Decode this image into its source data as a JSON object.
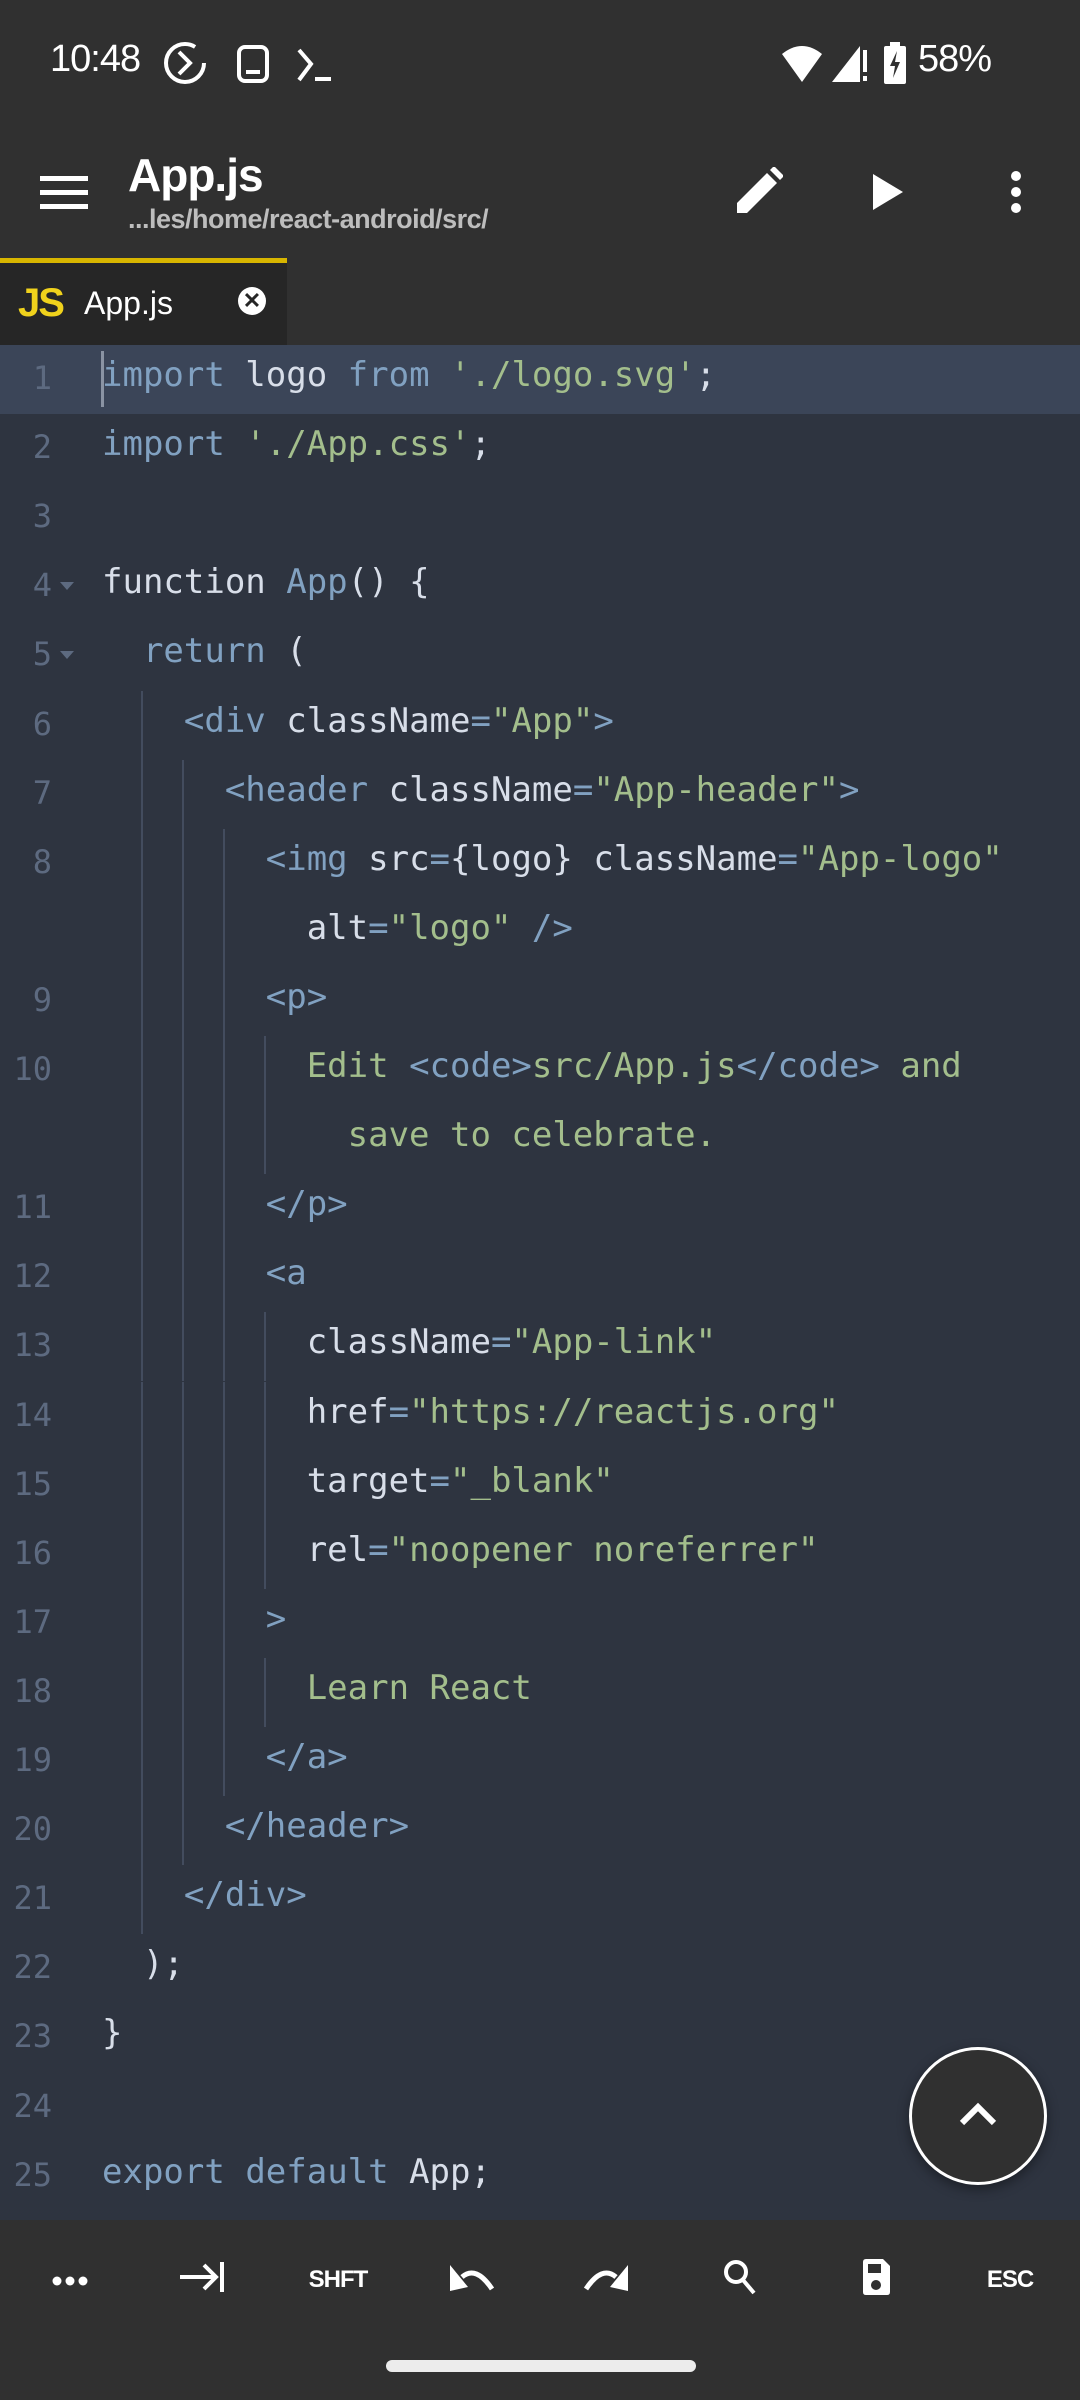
{
  "status_bar": {
    "time": "10:48",
    "left_icons": [
      "data-saver-icon",
      "tablet-icon",
      "terminal-icon"
    ],
    "right_icons": [
      "wifi-icon",
      "cell-signal-alert-icon",
      "battery-charging-icon"
    ],
    "battery_percent": "58%"
  },
  "app_bar": {
    "title": "App.js",
    "subtitle": "...les/home/react-android/src/",
    "actions": [
      "menu-icon",
      "edit-icon",
      "run-icon",
      "more-vert-icon"
    ]
  },
  "tabs": [
    {
      "icon_label": "JS",
      "label": "App.js",
      "active": true,
      "accent": "#d7b500"
    }
  ],
  "editor": {
    "active_line": 1,
    "theme_colors": {
      "background": "#2e3440",
      "active_line": "#3b4558",
      "keyword": "#81a1c1",
      "string": "#a3be8c",
      "text": "#d8dee9",
      "line_number": "#5d6a80"
    },
    "lines": [
      {
        "n": "1",
        "fold": false,
        "indent": 0,
        "wrap": false,
        "tokens": [
          [
            "k",
            "import"
          ],
          [
            "p",
            " logo "
          ],
          [
            "k",
            "from"
          ],
          [
            "p",
            " "
          ],
          [
            "s",
            "'./logo.svg'"
          ],
          [
            "p",
            ";"
          ]
        ]
      },
      {
        "n": "2",
        "fold": false,
        "indent": 0,
        "tokens": [
          [
            "k",
            "import"
          ],
          [
            "p",
            " "
          ],
          [
            "s",
            "'./App.css'"
          ],
          [
            "p",
            ";"
          ]
        ]
      },
      {
        "n": "3",
        "fold": false,
        "indent": 0,
        "tokens": []
      },
      {
        "n": "4",
        "fold": true,
        "indent": 0,
        "tokens": [
          [
            "p",
            "function "
          ],
          [
            "k",
            "App"
          ],
          [
            "p",
            "() {"
          ]
        ]
      },
      {
        "n": "5",
        "fold": true,
        "indent": 0,
        "tokens": [
          [
            "p",
            "  "
          ],
          [
            "k",
            "return"
          ],
          [
            "p",
            " ("
          ]
        ]
      },
      {
        "n": "6",
        "fold": false,
        "indent": 1,
        "tokens": [
          [
            "p",
            "    "
          ],
          [
            "k",
            "<div"
          ],
          [
            "p",
            " className"
          ],
          [
            "k",
            "="
          ],
          [
            "s",
            "\"App\""
          ],
          [
            "k",
            ">"
          ]
        ]
      },
      {
        "n": "7",
        "fold": false,
        "indent": 2,
        "tokens": [
          [
            "p",
            "      "
          ],
          [
            "k",
            "<header"
          ],
          [
            "p",
            " className"
          ],
          [
            "k",
            "="
          ],
          [
            "s",
            "\"App-header\""
          ],
          [
            "k",
            ">"
          ]
        ]
      },
      {
        "n": "8",
        "fold": false,
        "indent": 3,
        "tokens": [
          [
            "p",
            "        "
          ],
          [
            "k",
            "<img"
          ],
          [
            "p",
            " src"
          ],
          [
            "k",
            "="
          ],
          [
            "p",
            "{logo} className"
          ],
          [
            "k",
            "="
          ],
          [
            "s",
            "\"App-logo\""
          ]
        ]
      },
      {
        "n": "",
        "fold": false,
        "indent": 0,
        "wrap": true,
        "tokens": [
          [
            "p",
            "          alt"
          ],
          [
            "k",
            "="
          ],
          [
            "s",
            "\"logo\""
          ],
          [
            "p",
            " "
          ],
          [
            "k",
            "/>"
          ]
        ]
      },
      {
        "n": "9",
        "fold": false,
        "indent": 3,
        "tokens": [
          [
            "p",
            "        "
          ],
          [
            "k",
            "<p>"
          ]
        ]
      },
      {
        "n": "10",
        "fold": false,
        "indent": 4,
        "tokens": [
          [
            "p",
            "          "
          ],
          [
            "s",
            "Edit "
          ],
          [
            "k",
            "<code>"
          ],
          [
            "s",
            "src/App.js"
          ],
          [
            "k",
            "</code>"
          ],
          [
            "s",
            " and"
          ]
        ]
      },
      {
        "n": "",
        "fold": false,
        "indent": 0,
        "wrap": true,
        "tokens": [
          [
            "s",
            "            save to celebrate."
          ]
        ]
      },
      {
        "n": "11",
        "fold": false,
        "indent": 3,
        "tokens": [
          [
            "p",
            "        "
          ],
          [
            "k",
            "</p>"
          ]
        ]
      },
      {
        "n": "12",
        "fold": false,
        "indent": 3,
        "tokens": [
          [
            "p",
            "        "
          ],
          [
            "k",
            "<a"
          ]
        ]
      },
      {
        "n": "13",
        "fold": false,
        "indent": 4,
        "tokens": [
          [
            "p",
            "          className"
          ],
          [
            "k",
            "="
          ],
          [
            "s",
            "\"App-link\""
          ]
        ]
      },
      {
        "n": "14",
        "fold": false,
        "indent": 4,
        "tokens": [
          [
            "p",
            "          href"
          ],
          [
            "k",
            "="
          ],
          [
            "s",
            "\"https://reactjs.org\""
          ]
        ]
      },
      {
        "n": "15",
        "fold": false,
        "indent": 4,
        "tokens": [
          [
            "p",
            "          target"
          ],
          [
            "k",
            "="
          ],
          [
            "s",
            "\"_blank\""
          ]
        ]
      },
      {
        "n": "16",
        "fold": false,
        "indent": 4,
        "tokens": [
          [
            "p",
            "          rel"
          ],
          [
            "k",
            "="
          ],
          [
            "s",
            "\"noopener noreferrer\""
          ]
        ]
      },
      {
        "n": "17",
        "fold": false,
        "indent": 3,
        "tokens": [
          [
            "p",
            "        "
          ],
          [
            "k",
            ">"
          ]
        ]
      },
      {
        "n": "18",
        "fold": false,
        "indent": 4,
        "tokens": [
          [
            "p",
            "          "
          ],
          [
            "s",
            "Learn React"
          ]
        ]
      },
      {
        "n": "19",
        "fold": false,
        "indent": 3,
        "tokens": [
          [
            "p",
            "        "
          ],
          [
            "k",
            "</a>"
          ]
        ]
      },
      {
        "n": "20",
        "fold": false,
        "indent": 2,
        "tokens": [
          [
            "p",
            "      "
          ],
          [
            "k",
            "</header>"
          ]
        ]
      },
      {
        "n": "21",
        "fold": false,
        "indent": 1,
        "tokens": [
          [
            "p",
            "    "
          ],
          [
            "k",
            "</div>"
          ]
        ]
      },
      {
        "n": "22",
        "fold": false,
        "indent": 0,
        "tokens": [
          [
            "p",
            "  );"
          ]
        ]
      },
      {
        "n": "23",
        "fold": false,
        "indent": 0,
        "tokens": [
          [
            "p",
            "}"
          ]
        ]
      },
      {
        "n": "24",
        "fold": false,
        "indent": 0,
        "tokens": []
      },
      {
        "n": "25",
        "fold": false,
        "indent": 0,
        "tokens": [
          [
            "k",
            "export"
          ],
          [
            "p",
            " "
          ],
          [
            "k",
            "default"
          ],
          [
            "p",
            " App;"
          ]
        ]
      }
    ]
  },
  "fab": {
    "icon": "chevron-up-icon"
  },
  "bottom_toolbar": {
    "items": [
      {
        "name": "more-keys-button",
        "icon": "more-horiz-icon",
        "label": ""
      },
      {
        "name": "tab-key-button",
        "icon": "tab-icon",
        "label": ""
      },
      {
        "name": "shift-key-button",
        "icon": "",
        "label": "SHFT"
      },
      {
        "name": "undo-button",
        "icon": "undo-icon",
        "label": ""
      },
      {
        "name": "redo-button",
        "icon": "redo-icon",
        "label": ""
      },
      {
        "name": "search-button",
        "icon": "search-icon",
        "label": ""
      },
      {
        "name": "save-button",
        "icon": "save-icon",
        "label": ""
      },
      {
        "name": "esc-key-button",
        "icon": "",
        "label": "ESC"
      }
    ]
  }
}
